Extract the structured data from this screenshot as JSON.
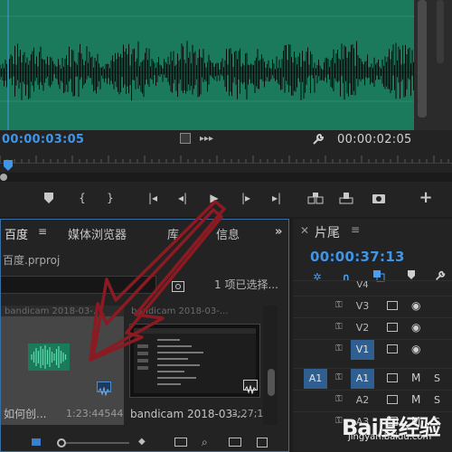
{
  "source_monitor": {
    "timecode_in": "00:00:03:05",
    "timecode_duration": "00:00:02:05"
  },
  "project_panel": {
    "tabs": [
      "百度",
      "媒体浏览器",
      "库",
      "信息"
    ],
    "project_name": "百度.prproj",
    "search_placeholder": "",
    "selection_count": "1 项已选择...",
    "items": [
      {
        "top_caption": "bandicam 2018-03-...",
        "name": "如何创...",
        "duration": "1:23:44544"
      },
      {
        "top_caption": "bandicam 2018-03-...",
        "name": "bandicam 2018-03-...",
        "duration": "3;27;18"
      }
    ]
  },
  "timeline_panel": {
    "title": "片尾",
    "timecode": "00:00:37:13",
    "tracks": [
      {
        "name": "V4",
        "source": ""
      },
      {
        "name": "V3",
        "source": ""
      },
      {
        "name": "V2",
        "source": ""
      },
      {
        "name": "V1",
        "source": ""
      },
      {
        "name": "A1",
        "source": "A1"
      },
      {
        "name": "A2",
        "source": ""
      },
      {
        "name": "A3",
        "source": ""
      }
    ]
  },
  "watermark": {
    "brand": "Bai度经验",
    "url": "jingyan.baidu.com"
  },
  "colors": {
    "accent_blue": "#3f95e8",
    "waveform_bg": "#1b7a5c",
    "annotation_arrow": "#8b1a22"
  }
}
